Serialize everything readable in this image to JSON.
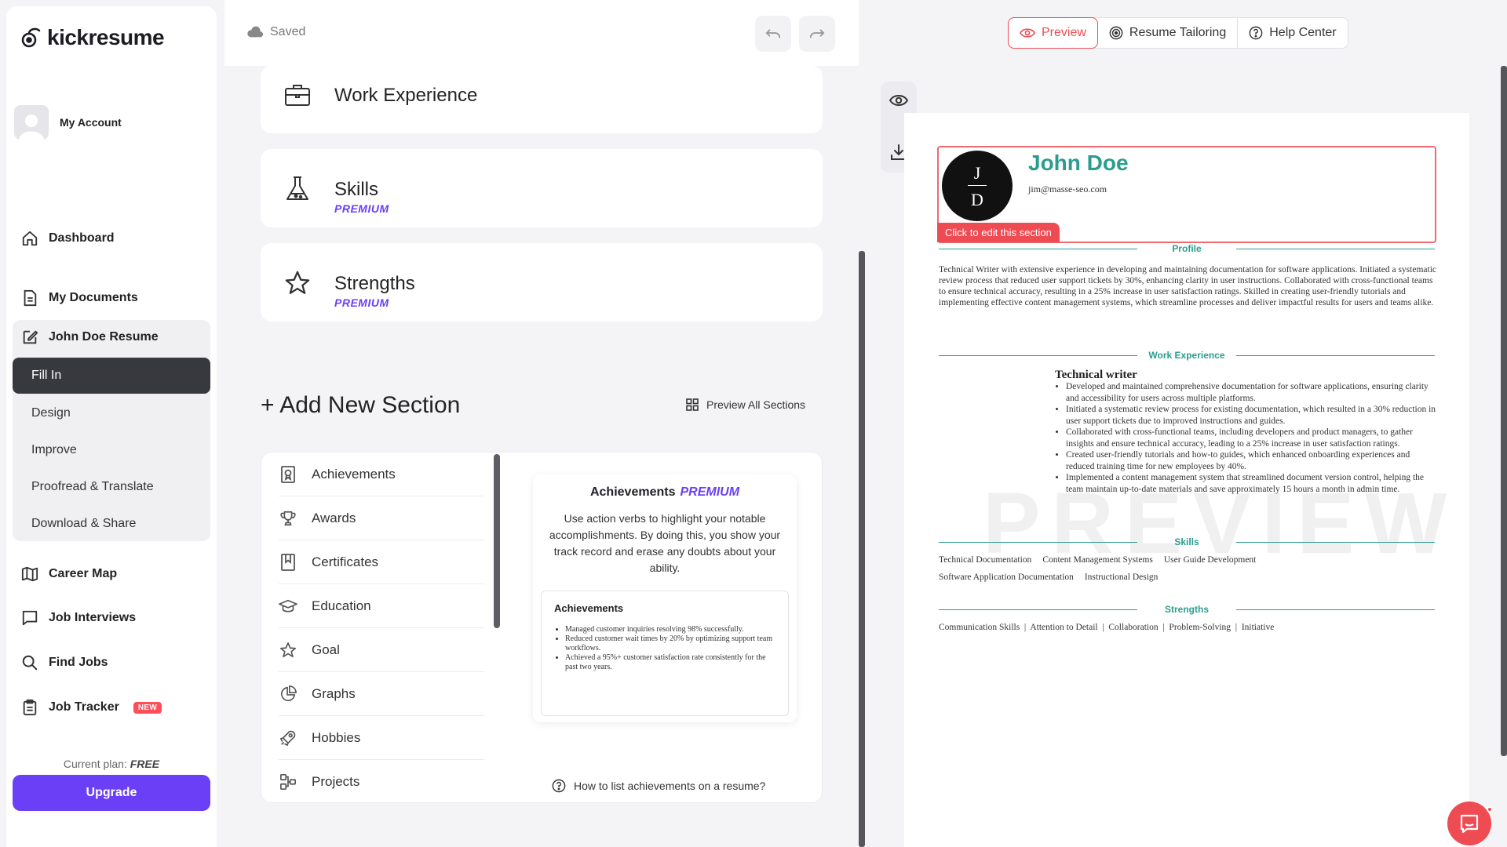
{
  "brand": {
    "name": "kickresume"
  },
  "account": {
    "label": "My Account"
  },
  "nav": {
    "dashboard": "Dashboard",
    "my_documents": "My Documents",
    "resume": "John Doe Resume",
    "sub": [
      "Fill In",
      "Design",
      "Improve",
      "Proofread & Translate",
      "Download & Share"
    ],
    "career_map": "Career Map",
    "job_interviews": "Job Interviews",
    "find_jobs": "Find Jobs",
    "job_tracker": "Job Tracker",
    "new_badge": "NEW"
  },
  "plan": {
    "label": "Current plan:",
    "value": "FREE"
  },
  "upgrade_label": "Upgrade",
  "editor": {
    "saved": "Saved",
    "sections": [
      {
        "title": "Work Experience",
        "premium": ""
      },
      {
        "title": "Skills",
        "premium": "PREMIUM"
      },
      {
        "title": "Strengths",
        "premium": "PREMIUM"
      }
    ],
    "add_section": "+ Add New Section",
    "preview_all": "Preview All Sections",
    "section_types": [
      "Achievements",
      "Awards",
      "Certificates",
      "Education",
      "Goal",
      "Graphs",
      "Hobbies",
      "Projects"
    ],
    "card": {
      "title": "Achievements",
      "premium": "PREMIUM",
      "description": "Use action verbs to highlight your notable accomplishments. By doing this, you show your track record and erase any doubts about your ability.",
      "sample_title": "Achievements",
      "sample_items": [
        "Managed customer inquiries resolving 98% successfully.",
        "Reduced customer wait times by 20% by optimizing support team workflows.",
        "Achieved a 95%+ customer satisfaction rate consistently for the past two years."
      ],
      "howto": "How to list achievements on a resume?"
    }
  },
  "preview": {
    "tabs": [
      "Preview",
      "Resume Tailoring",
      "Help Center"
    ],
    "watermark": "PREVIEW",
    "resume": {
      "monogram_top": "J",
      "monogram_bottom": "D",
      "name": "John Doe",
      "email": "jim@masse-seo.com",
      "edit_tag": "Click to edit this section",
      "profile_title": "Profile",
      "profile_text": "Technical Writer with extensive experience in developing and maintaining documentation for software applications. Initiated a systematic review process that reduced user support tickets by 30%, enhancing clarity in user instructions. Collaborated with cross-functional teams to ensure technical accuracy, resulting in a 25% increase in user satisfaction ratings. Skilled in creating user-friendly tutorials and implementing effective content management systems, which streamline processes and deliver impactful results for users and teams alike.",
      "work_title": "Work Experience",
      "job_title": "Technical writer",
      "job_bullets": [
        "Developed and maintained comprehensive documentation for software applications, ensuring clarity and accessibility for users across multiple platforms.",
        "Initiated a systematic review process for existing documentation, which resulted in a 30% reduction in user support tickets due to improved instructions and guides.",
        "Collaborated with cross-functional teams, including developers and product managers, to gather insights and ensure technical accuracy, leading to a 25% increase in user satisfaction ratings.",
        "Created user-friendly tutorials and how-to guides, which enhanced onboarding experiences and reduced training time for new employees by 40%.",
        "Implemented a content management system that streamlined document version control, helping the team maintain up-to-date materials and save approximately 15 hours a month in admin time."
      ],
      "skills_title": "Skills",
      "skills": [
        "Technical Documentation",
        "Content Management Systems",
        "User Guide Development",
        "Software Application Documentation",
        "Instructional Design"
      ],
      "strengths_title": "Strengths",
      "strengths": "Communication Skills  |  Attention to Detail  |  Collaboration  |  Problem-Solving  |  Initiative"
    }
  },
  "colors": {
    "accent": "#6b3ff5",
    "brand_red": "#ef4b53",
    "resume_teal": "#2a9d8f"
  }
}
